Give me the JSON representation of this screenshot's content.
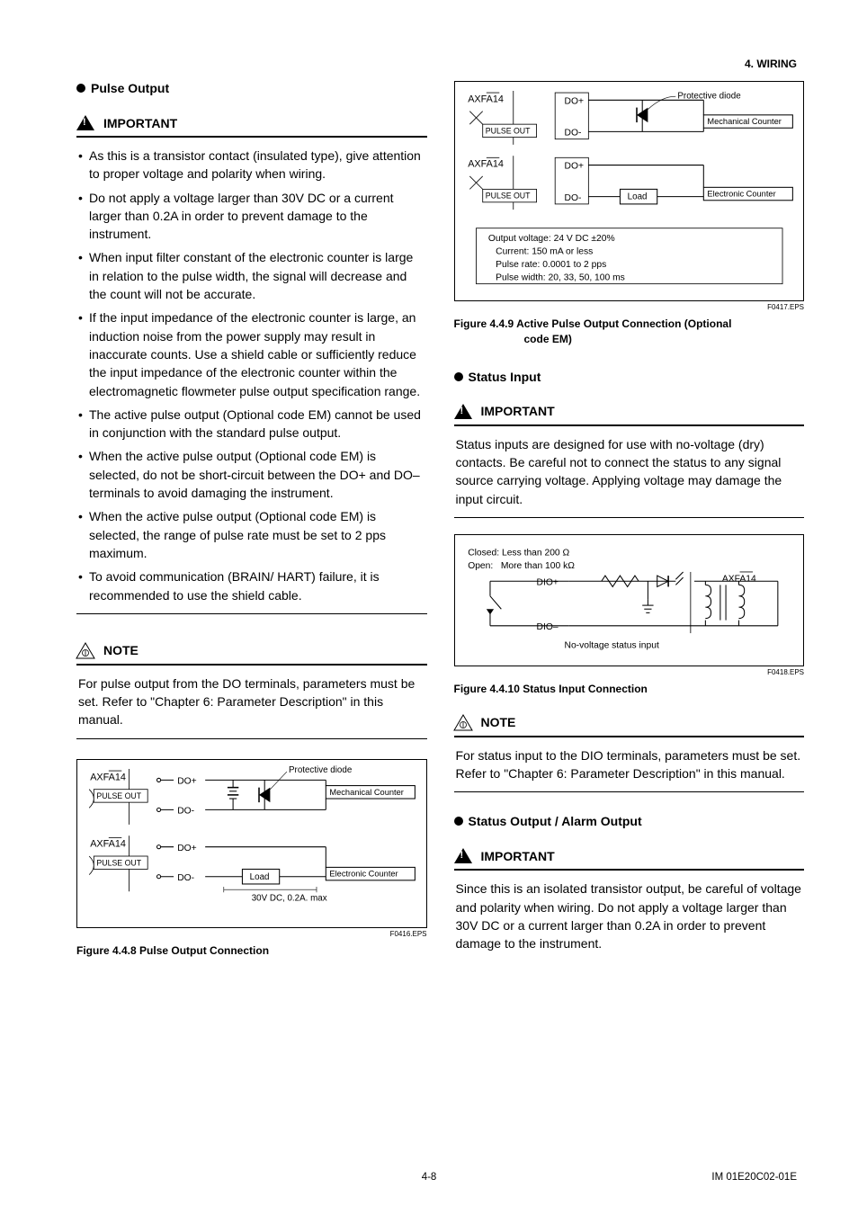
{
  "header": {
    "section": "4.  WIRING"
  },
  "left": {
    "heading": "Pulse Output",
    "important_label": "IMPORTANT",
    "bullets": [
      "As this is a transistor contact (insulated type), give attention to proper voltage and polarity when wiring.",
      "Do not apply a voltage larger than 30V DC or a current larger than 0.2A in order to prevent damage to the instrument.",
      "When input filter constant of the electronic counter is large in relation to the pulse width, the signal will decrease and the count will not be accurate.",
      "If the input impedance of the electronic counter is large, an induction noise from the power supply may result in inaccurate counts.  Use a shield cable or sufficiently reduce the input impedance of the electronic counter within the electromagnetic flowmeter pulse output specification range.",
      "The active pulse output (Optional code EM) cannot be used in conjunction with the standard pulse output.",
      "When the active pulse output (Optional code EM) is selected, do not be short-circuit between the DO+ and DO– terminals to avoid damaging the instrument.",
      "When the active pulse output (Optional code EM) is selected, the range of pulse rate must be set to 2 pps maximum.",
      "To avoid communication (BRAIN/ HART) failure, it is recommended to use the shield cable."
    ],
    "note_label": "NOTE",
    "note_text": "For pulse output from the DO terminals, parameters must be set. Refer to \"Chapter 6: Parameter Description\" in this manual.",
    "fig448": {
      "axfa": "AXFA14",
      "pulseout": "PULSE OUT",
      "do_plus": "DO+",
      "do_minus": "DO-",
      "protective": "Protective diode",
      "mech": "Mechanical Counter",
      "load": "Load",
      "elec": "Electronic Counter",
      "rating": "30V DC, 0.2A. max",
      "eps": "F0416.EPS",
      "title": "Figure 4.4.8    Pulse Output Connection"
    }
  },
  "right": {
    "fig449": {
      "axfa": "AXFA14",
      "pulseout": "PULSE OUT",
      "do_plus": "DO+",
      "do_minus": "DO-",
      "protective": "Protective diode",
      "mech": "Mechanical Counter",
      "load": "Load",
      "elec": "Electronic Counter",
      "spec1": "Output voltage: 24 V DC ±20%",
      "spec2": "Current: 150 mA or less",
      "spec3": "Pulse rate: 0.0001 to 2 pps",
      "spec4": "Pulse width: 20, 33, 50, 100 ms",
      "eps": "F0417.EPS",
      "title_a": "Figure 4.4.9    Active Pulse Output Connection (Optional",
      "title_b": "code EM)"
    },
    "status_input_heading": "Status Input",
    "important_label": "IMPORTANT",
    "important_text": "Status inputs are designed for use with no-voltage (dry) contacts. Be careful not to connect the status to any signal source carrying voltage. Applying voltage may damage the input circuit.",
    "fig4410": {
      "closed": "Closed: Less than 200 Ω",
      "open": "Open:   More than 100 kΩ",
      "dio_plus": "DIO+",
      "dio_minus": "DIO–",
      "axfa": "AXFA14",
      "novolt": "No-voltage status input",
      "eps": "F0418.EPS",
      "title": "Figure 4.4.10  Status Input Connection"
    },
    "note_label": "NOTE",
    "note_text": "For status input to the DIO terminals, parameters must be set. Refer to \"Chapter 6: Parameter Description\" in this manual.",
    "status_output_heading": "Status Output / Alarm Output",
    "important2_label": "IMPORTANT",
    "important2_text": "Since this is an isolated transistor output, be careful of voltage and polarity when wiring. Do not apply a voltage larger than 30V DC or a current larger than 0.2A in order to prevent damage to the instrument."
  },
  "footer": {
    "page": "4-8",
    "doc": "IM 01E20C02-01E"
  }
}
